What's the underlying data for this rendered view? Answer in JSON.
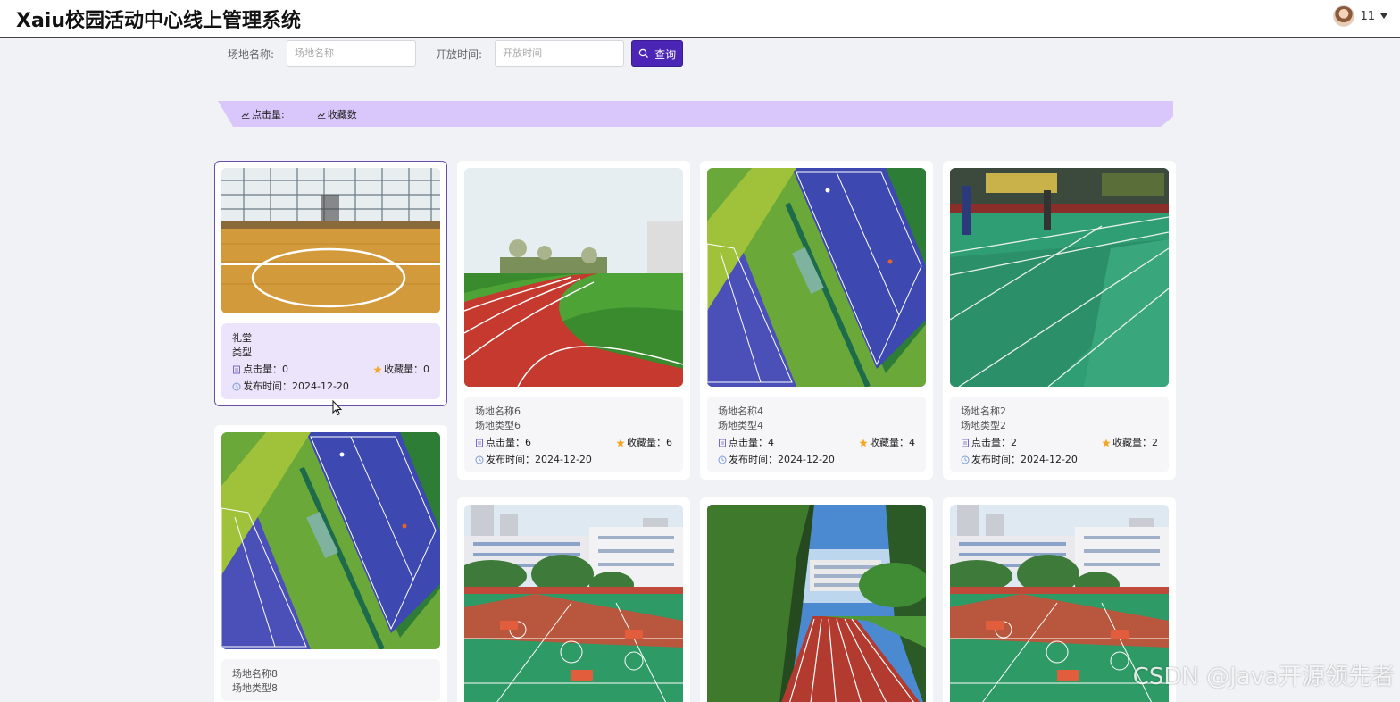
{
  "header": {
    "title": "Xaiu校园活动中心线上管理系统",
    "user_name": "11"
  },
  "search": {
    "field1_label": "场地名称:",
    "field1_placeholder": "场地名称",
    "field2_label": "开放时间:",
    "field2_placeholder": "开放时间",
    "button_label": "查询"
  },
  "sort": {
    "clicks_label": "点击量:",
    "favorites_label": "收藏数"
  },
  "cards": [
    {
      "name": "礼堂",
      "type": "类型",
      "clicks": "点击量：0",
      "favorites": "收藏量：0",
      "date": "发布时间：2024-12-20",
      "image": "basketball-court-indoor",
      "active": true
    },
    {
      "name": "场地名称6",
      "type": "场地类型6",
      "clicks": "点击量：6",
      "favorites": "收藏量：6",
      "date": "发布时间：2024-12-20",
      "image": "running-track"
    },
    {
      "name": "场地名称4",
      "type": "场地类型4",
      "clicks": "点击量：4",
      "favorites": "收藏量：4",
      "date": "发布时间：2024-12-20",
      "image": "tennis-court-aerial"
    },
    {
      "name": "场地名称2",
      "type": "场地类型2",
      "clicks": "点击量：2",
      "favorites": "收藏量：2",
      "date": "发布时间：2024-12-20",
      "image": "badminton-hall"
    },
    {
      "name": "场地名称8",
      "type": "场地类型8",
      "image": "tennis-court-aerial"
    },
    {
      "image": "outdoor-basketball-courts"
    },
    {
      "image": "running-track-trees"
    },
    {
      "image": "outdoor-basketball-courts"
    }
  ],
  "watermark": "CSDN @Java开源领先者",
  "colors": {
    "primary": "#4b25b5",
    "sort_bar": "#d9c7fb",
    "active_border": "#6a4fa8",
    "star": "#f5a623"
  }
}
